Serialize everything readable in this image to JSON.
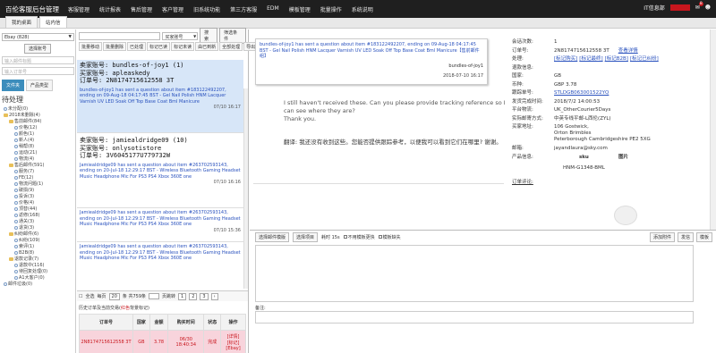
{
  "header": {
    "brand": "百伦客服后台管理",
    "menu": [
      "客服管理",
      "统计报表",
      "售后管理",
      "客户管理",
      "旧系统功能",
      "第三方客服",
      "EDM",
      "模板管理",
      "批量操作",
      "系统说明"
    ],
    "user": "IT信息部",
    "bell_count": "8"
  },
  "tabs": [
    {
      "label": "我的桌面"
    },
    {
      "label": "站内信"
    }
  ],
  "left": {
    "account_select": "Ebay (828)",
    "select_account_btn": "选择账号",
    "input1_placeholder": "输入邮件标题",
    "input2_placeholder": "输入订单号",
    "tab_folder": "文件夹",
    "tab_product": "产品类型",
    "heading": "待处理",
    "tree": [
      {
        "label": "未分配(0)",
        "level": 0,
        "type": "o"
      },
      {
        "label": "2018未删除(4)",
        "level": 0,
        "type": "f"
      },
      {
        "label": "售前邮件(84)",
        "level": 1,
        "type": "f"
      },
      {
        "label": "价格(12)",
        "level": 2,
        "type": "o"
      },
      {
        "label": "颜色(1)",
        "level": 2,
        "type": "o"
      },
      {
        "label": "新人(4)",
        "level": 2,
        "type": "o"
      },
      {
        "label": "稍帮(8)",
        "level": 2,
        "type": "o"
      },
      {
        "label": "运动(21)",
        "level": 2,
        "type": "o"
      },
      {
        "label": "物流(4)",
        "level": 2,
        "type": "o"
      },
      {
        "label": "售后邮件(591)",
        "level": 1,
        "type": "f"
      },
      {
        "label": "服务(7)",
        "level": 2,
        "type": "o"
      },
      {
        "label": "FE(12)",
        "level": 2,
        "type": "o"
      },
      {
        "label": "物流问题(1)",
        "level": 2,
        "type": "o"
      },
      {
        "label": "破损(9)",
        "level": 2,
        "type": "o"
      },
      {
        "label": "投诉(3)",
        "level": 2,
        "type": "o"
      },
      {
        "label": "价格(4)",
        "level": 2,
        "type": "o"
      },
      {
        "label": "顶替(44)",
        "level": 2,
        "type": "o"
      },
      {
        "label": "返修(168)",
        "level": 2,
        "type": "o"
      },
      {
        "label": "通关(3)",
        "level": 2,
        "type": "o"
      },
      {
        "label": "退货(3)",
        "level": 2,
        "type": "o"
      },
      {
        "label": "纠纷邮件(6)",
        "level": 1,
        "type": "f"
      },
      {
        "label": "纠纷(109)",
        "level": 2,
        "type": "o"
      },
      {
        "label": "索评(1)",
        "level": 2,
        "type": "o"
      },
      {
        "label": "B2B(8)",
        "level": 2,
        "type": "o"
      },
      {
        "label": "退款记录(7)",
        "level": 1,
        "type": "f"
      },
      {
        "label": "退款中(116)",
        "level": 2,
        "type": "o"
      },
      {
        "label": "待回复处理(0)",
        "level": 2,
        "type": "o"
      },
      {
        "label": "A1大客户(0)",
        "level": 2,
        "type": "o"
      },
      {
        "label": "邮件垃圾(0)",
        "level": 0,
        "type": "o"
      }
    ]
  },
  "middle": {
    "account_type": "买家账号",
    "search_btn": "搜索",
    "filter_btn": "筛选条件",
    "toolbar": [
      "批量移动",
      "批量删除",
      "已处理",
      "标记已读",
      "标记未读",
      "由已到新",
      "全部处理",
      "导出"
    ],
    "messages": [
      {
        "seller": "卖家账号: bundles-of-joy1 (1)",
        "buyer": "买家账号: apleaskedy",
        "order": "订单号: 2N8174715612558 3T",
        "snippet": "bundles-of-joy1 has sent a question about item #183122492207, ending on 09-Aug-18 04:17:45 BST - Gel Nail Polish HNM Lacquer Varnish UV LED Soak Off Top Base Coat Bml Manicure",
        "time": "07/10 16:17"
      },
      {
        "seller": "卖家账号: jamiealdridge09 (10)",
        "buyer": "买家账号: onlysotistore",
        "order": "订单号: 3V6045177U779732W",
        "snippet": "Jamiealdridge09 has sent a question about item #263702593143, ending on 20-Jul-18 12:29:17 BST - Wireless Bluetooth Gaming Headset Music Headphone Mic For PS3 PS4 Xbox 360E one",
        "time": "07/10 16:16"
      },
      {
        "snippet": "Jamiealdridge09 has sent a question about item #263702593143, ending on 20-Jul-18 12:29:17 BST - Wireless Bluetooth Gaming Headset Music Headphone Mic For PS3 PS4 Xbox 360E one",
        "time": "07/10 15:36"
      },
      {
        "snippet": "Jamiealdridge09 has sent a question about item #263702593143, ending on 20-Jul-18 12:29:17 BST - Wireless Bluetooth Gaming Headset Music Headphone Mic For PS3 PS4 Xbox 360E one",
        "time": ""
      }
    ],
    "pager": {
      "select_all": "全选",
      "per_page_label": "每页",
      "per_page": "20",
      "total": "条  共759条",
      "goto": "页跳转",
      "pages": [
        "1",
        "2",
        "3"
      ]
    },
    "history": {
      "title": "历史订单及当前交易(",
      "red": "红色",
      "title_end": "背景标记)",
      "columns": [
        "订单号",
        "国家",
        "金额",
        "购买时间",
        "状态",
        "操作"
      ],
      "rows": [
        [
          "2N8174715612558 3T",
          "GB",
          "3.78",
          "06/30 18:40:34",
          "完成",
          "[详情]\n[标记]\n[Ebay]"
        ]
      ]
    }
  },
  "right": {
    "message": {
      "text": "bundles-of-joy1 has sent a question about item #183122492207, ending on 09-Aug-18 04:17:45 BST - Gel Nail Polish HNM Lacquer Varnish UV LED Soak Off Top Base Coat Bml Manicure【售前邮件组】",
      "sender": "bundles-of-joy1",
      "time": "2018-07-10 16:17"
    },
    "reply": "I still haven't received these. Can you please provide tracking reference so I can see where they are?\nThank you.",
    "translation": "翻译:  我还没有收到这些。您能否提供跟踪参考，以便我可以看到它们在哪里? 谢谢。",
    "info": [
      {
        "k": "会话次数:",
        "v": "1"
      },
      {
        "k": "订单号:",
        "v": "2N8174715612558 3T",
        "link": "查看详情"
      },
      {
        "k": "处理:",
        "links": [
          "[标记购买]",
          "[标记最终]",
          "[标记B2B]",
          "[标记已纠纷]"
        ]
      },
      {
        "k": "退款信息:",
        "v": ""
      },
      {
        "k": "国家:",
        "v": "GB"
      },
      {
        "k": "币种:",
        "v": "GBP 3.78"
      },
      {
        "k": "跟踪单号:",
        "v": "",
        "link": "STLDGB063001522YQ"
      },
      {
        "k": "发货完成时间:",
        "v": "2018/7/2 14:00:53"
      },
      {
        "k": "平台物流:",
        "v": "UK_OtherCourier5Days"
      },
      {
        "k": "实际邮寄方式:",
        "v": "中英专线平邮-L西伦(ZYL)"
      },
      {
        "k": "买家地址:",
        "v": "106 Gostwick,\nOrton Brimbles\nPeterborough Cambridgeshire PE2 5XG"
      },
      {
        "k": "邮箱:",
        "v": "jayandlaura@sky.com"
      },
      {
        "k": "产品信息:",
        "sku_label": "sku",
        "img_label": "图片",
        "sku": "HNM-G1348-BML"
      },
      {
        "k": "订单评论:",
        "v": ""
      }
    ],
    "compose": {
      "template_btn": "选择邮件模版",
      "item_btn": "选择项目",
      "remark": "耗时 15s",
      "check1": "不用模板更快",
      "check2": "模板缺失",
      "buttons": [
        "添加附件",
        "发信",
        "模板"
      ],
      "note_label": "备注:"
    }
  },
  "colors": {
    "topnav_bg": "#1f1f1f",
    "accent_blue": "#3c8dbc",
    "selected_row_bg": "#d7e6f8",
    "history_row_bg": "#f8d4dc",
    "link_blue": "#2a52be",
    "red": "#c8161d"
  }
}
